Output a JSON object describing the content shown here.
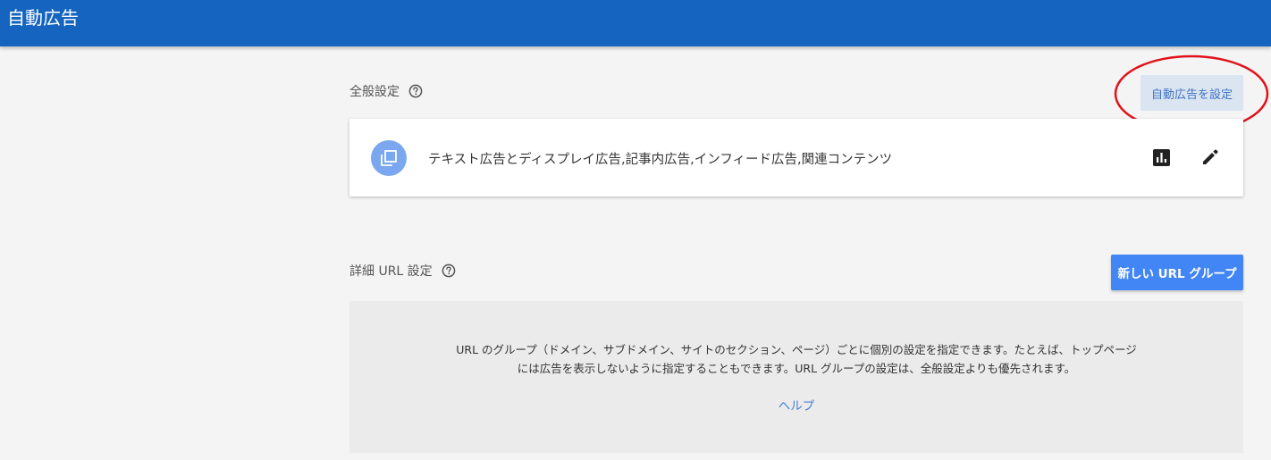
{
  "header": {
    "title": "自動広告"
  },
  "general": {
    "heading": "全般設定",
    "set_auto_ads_label": "自動広告を設定",
    "ad_formats": "テキスト広告とディスプレイ広告,記事内広告,インフィード広告,関連コンテンツ"
  },
  "advanced": {
    "heading": "詳細 URL 設定",
    "new_group_label": "新しい URL グループ",
    "description_line1": "URL のグループ（ドメイン、サブドメイン、サイトのセクション、ページ）ごとに個別の設定を指定できます。たとえば、トップページ",
    "description_line2": "には広告を表示しないように指定することもできます。URL グループの設定は、全般設定よりも優先されます。",
    "help_label": "ヘルプ"
  },
  "colors": {
    "header_bg": "#1565c0",
    "primary_button": "#4285f4",
    "annotation_circle": "#e0121a"
  },
  "icons": [
    "help-circle-icon",
    "ad-formats-icon",
    "bar-chart-icon",
    "edit-pencil-icon"
  ]
}
